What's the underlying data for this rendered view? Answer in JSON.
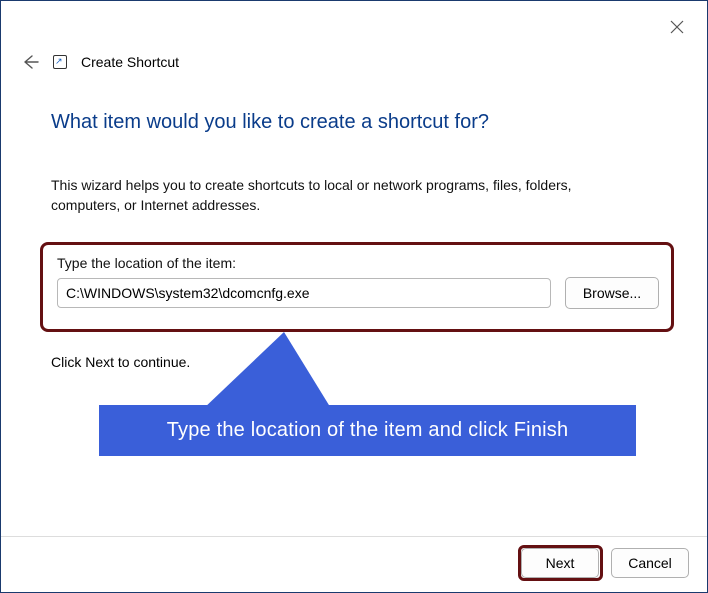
{
  "window": {
    "title": "Create Shortcut"
  },
  "heading": "What item would you like to create a shortcut for?",
  "description": "This wizard helps you to create shortcuts to local or network programs, files, folders, computers, or Internet addresses.",
  "location": {
    "label": "Type the location of the item:",
    "value": "C:\\WINDOWS\\system32\\dcomcnfg.exe",
    "browse_label": "Browse..."
  },
  "continue_hint": "Click Next to continue.",
  "callout": "Type the location of the item and click Finish",
  "footer": {
    "next": "Next",
    "cancel": "Cancel"
  }
}
